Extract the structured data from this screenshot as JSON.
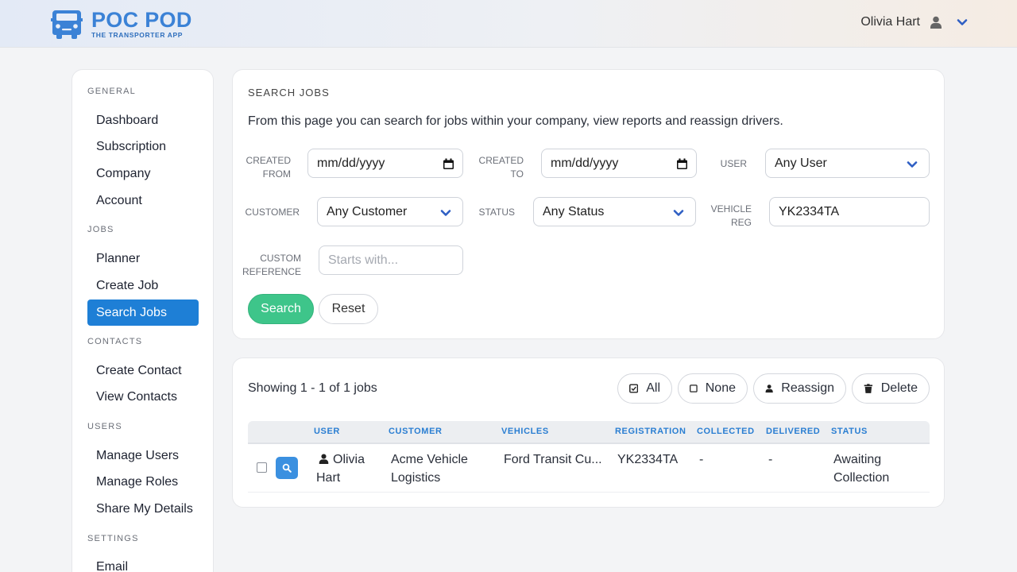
{
  "app": {
    "logo_main": "POC POD",
    "logo_sub": "THE TRANSPORTER APP",
    "brand_color": "#3b82d6"
  },
  "header": {
    "user_name": "Olivia Hart"
  },
  "sidebar": {
    "sections": [
      {
        "title": "GENERAL",
        "items": [
          "Dashboard",
          "Subscription",
          "Company",
          "Account"
        ]
      },
      {
        "title": "JOBS",
        "items": [
          "Planner",
          "Create Job",
          "Search Jobs"
        ]
      },
      {
        "title": "CONTACTS",
        "items": [
          "Create Contact",
          "View Contacts"
        ]
      },
      {
        "title": "USERS",
        "items": [
          "Manage Users",
          "Manage Roles",
          "Share My Details"
        ]
      },
      {
        "title": "SETTINGS",
        "items": [
          "Email"
        ]
      }
    ],
    "active_item": "Search Jobs",
    "active_color": "#1e7fd6"
  },
  "search": {
    "title": "SEARCH JOBS",
    "intro": "From this page you can search for jobs within your company, view reports and reassign drivers.",
    "labels": {
      "created_from": [
        "CREATED",
        "FROM"
      ],
      "created_to": [
        "CREATED",
        "TO"
      ],
      "user": "USER",
      "customer": "CUSTOMER",
      "status": "STATUS",
      "vehicle_reg": [
        "VEHICLE",
        "REG"
      ],
      "custom_reference": [
        "CUSTOM",
        "REFERENCE"
      ]
    },
    "values": {
      "created_from": "mm/dd/yyyy",
      "created_to": "mm/dd/yyyy",
      "user": "Any User",
      "customer": "Any Customer",
      "status": "Any Status",
      "vehicle_reg": "YK2334TA"
    },
    "placeholders": {
      "custom_reference": "Starts with..."
    },
    "buttons": {
      "search": "Search",
      "reset": "Reset"
    },
    "search_color": "#3ec58a"
  },
  "results": {
    "summary": "Showing 1 - 1 of 1 jobs",
    "actions": {
      "all": "All",
      "none": "None",
      "reassign": "Reassign",
      "delete": "Delete"
    },
    "columns": [
      "USER",
      "CUSTOMER",
      "VEHICLES",
      "REGISTRATION",
      "COLLECTED",
      "DELIVERED",
      "STATUS"
    ],
    "rows": [
      {
        "user": "Olivia Hart",
        "customer": "Acme Vehicle Logistics",
        "vehicles": "Ford Transit Cu...",
        "registration": "YK2334TA",
        "collected": "-",
        "delivered": "-",
        "status": "Awaiting Collection"
      }
    ],
    "header_color": "#2a7ed2"
  }
}
